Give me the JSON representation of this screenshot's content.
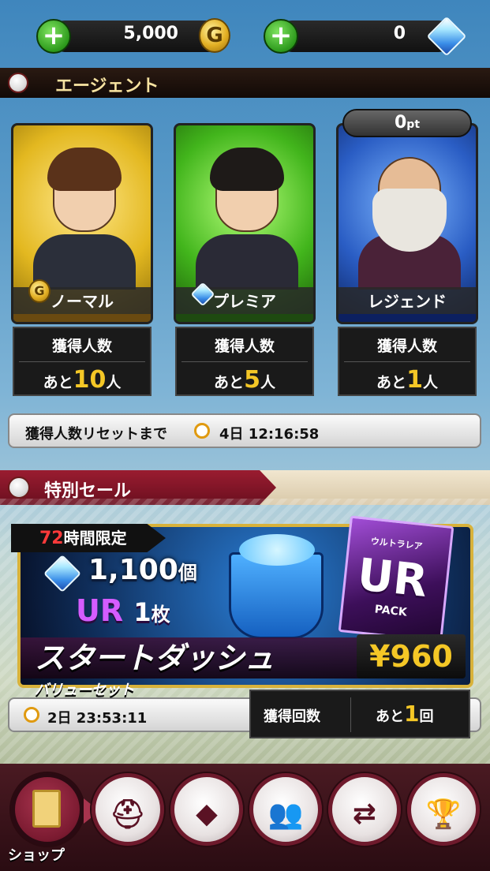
{
  "currency": {
    "coins": "5,000",
    "coin_symbol": "G",
    "gems": "0",
    "plus_label": "+"
  },
  "agent_section": {
    "title": "エージェント",
    "cards": [
      {
        "name": "ノーマル",
        "count_label": "獲得人数",
        "prefix": "あと",
        "count": "10",
        "suffix": "人"
      },
      {
        "name": "プレミア",
        "count_label": "獲得人数",
        "prefix": "あと",
        "count": "5",
        "suffix": "人"
      },
      {
        "name": "レジェンド",
        "count_label": "獲得人数",
        "prefix": "あと",
        "count": "1",
        "suffix": "人"
      }
    ],
    "legend_points": "0",
    "legend_points_unit": "pt",
    "reset_label": "獲得人数リセットまで",
    "reset_time": "4日 12:16:58"
  },
  "sale_section": {
    "title": "特別セール",
    "limit_hours": "72",
    "limit_label": "時間限定",
    "gems_amount": "1,100",
    "gems_unit": "個",
    "ur_label": "UR",
    "ur_count": "1",
    "ur_unit": "枚",
    "pack_title": "スタートダッシュ",
    "pack_subtitle": "バリューセット",
    "price": "¥960",
    "pack_small_label": "ウルトラレア",
    "pack_ur_label": "UR",
    "pack_label": "PACK",
    "timer": "2日 23:53:11",
    "got_label": "獲得回数",
    "got_prefix": "あと",
    "got_count": "1",
    "got_suffix": "回"
  },
  "bottom_nav": {
    "shop_label": "ショップ",
    "items": [
      "shop-icon",
      "helmet-icon",
      "field-icon",
      "team-icon",
      "trade-icon",
      "trophy-icon"
    ]
  },
  "colors": {
    "accent_gold": "#f4c726",
    "maroon": "#7a1428",
    "header_text": "#f7e3a1"
  }
}
